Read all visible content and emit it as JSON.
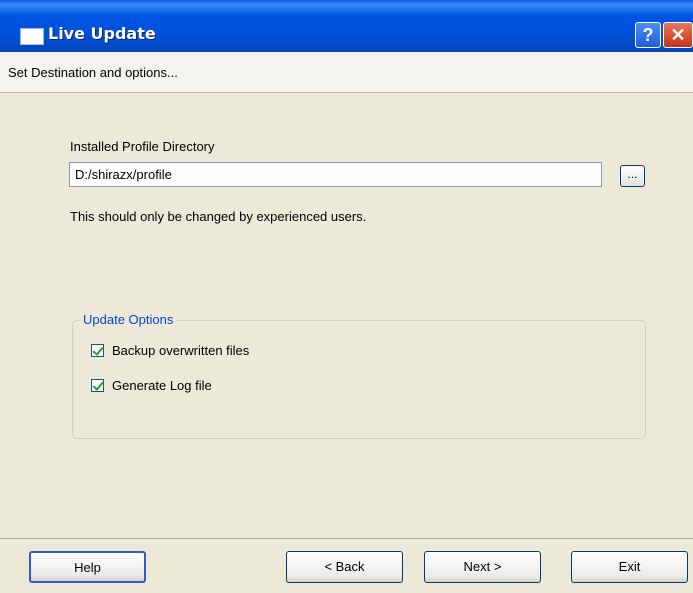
{
  "window": {
    "title": "Live Update",
    "help_glyph": "?",
    "close_glyph": "✕"
  },
  "subheader": {
    "text": "Set Destination and options..."
  },
  "profile": {
    "label": "Installed Profile Directory",
    "path_value": "D:/shirazx/profile",
    "browse_label": "...",
    "note": "This should only be changed by experienced users."
  },
  "update_options": {
    "title": "Update Options",
    "options": [
      {
        "label": "Backup overwritten files",
        "checked": true
      },
      {
        "label": "Generate Log file",
        "checked": true
      }
    ]
  },
  "buttons": {
    "help": "Help",
    "back": "< Back",
    "next": "Next >",
    "exit": "Exit"
  },
  "colors": {
    "titlebar": "#0054e3",
    "group_title": "#0046d5",
    "dialog_bg": "#ece9d8"
  }
}
